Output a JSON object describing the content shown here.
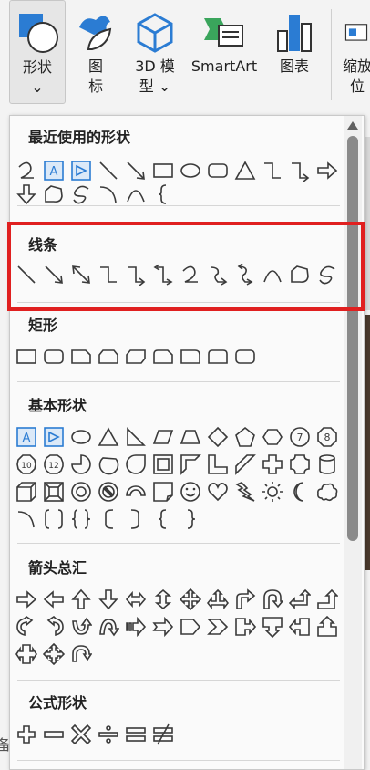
{
  "ribbon": {
    "shapes_label": "形状",
    "shapes_chevron": "⌄",
    "icons_label": "图\n标",
    "model3d_label": "3D 模\n型 ⌄",
    "smartart_label": "SmartArt",
    "chart_label": "图表",
    "zoom_label": "缩放\n位"
  },
  "sections": {
    "recent": "最近使用的形状",
    "lines": "线条",
    "rect": "矩形",
    "basic": "基本形状",
    "arrows": "箭头总汇",
    "equation": "公式形状"
  },
  "left_edge_char": "备",
  "colors": {
    "accent": "#2b7cd3",
    "highlight": "#e02020",
    "stroke": "#3a3a3a"
  }
}
